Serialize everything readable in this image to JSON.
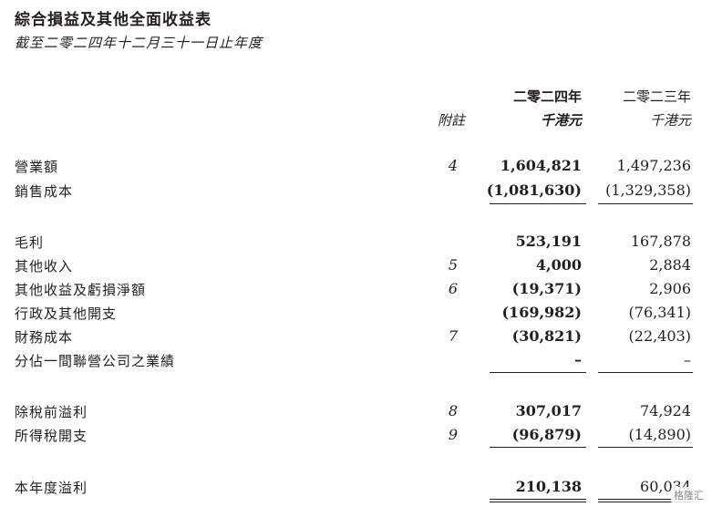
{
  "title": "綜合損益及其他全面收益表",
  "subtitle": "截至二零二四年十二月三十一日止年度",
  "columns": {
    "note_header": "附註",
    "year_2024": "二零二四年",
    "year_2023": "二零二三年",
    "unit_2024": "千港元",
    "unit_2023": "千港元"
  },
  "rows": [
    {
      "label": "營業額",
      "note": "4",
      "v2024": "1,604,821",
      "v2023": "1,497,236"
    },
    {
      "label": "銷售成本",
      "note": "",
      "v2024": "(1,081,630)",
      "v2023": "(1,329,358)"
    },
    {
      "label": "毛利",
      "note": "",
      "v2024": "523,191",
      "v2023": "167,878"
    },
    {
      "label": "其他收入",
      "note": "5",
      "v2024": "4,000",
      "v2023": "2,884"
    },
    {
      "label": "其他收益及虧損淨額",
      "note": "6",
      "v2024": "(19,371)",
      "v2023": "2,906"
    },
    {
      "label": "行政及其他開支",
      "note": "",
      "v2024": "(169,982)",
      "v2023": "(76,341)"
    },
    {
      "label": "財務成本",
      "note": "7",
      "v2024": "(30,821)",
      "v2023": "(22,403)"
    },
    {
      "label": "分佔一間聯營公司之業績",
      "note": "",
      "v2024": "–",
      "v2023": "–"
    },
    {
      "label": "除稅前溢利",
      "note": "8",
      "v2024": "307,017",
      "v2023": "74,924"
    },
    {
      "label": "所得稅開支",
      "note": "9",
      "v2024": "(96,879)",
      "v2023": "(14,890)"
    },
    {
      "label": "本年度溢利",
      "note": "",
      "v2024": "210,138",
      "v2023": "60,034"
    }
  ],
  "watermark": "格隆汇"
}
